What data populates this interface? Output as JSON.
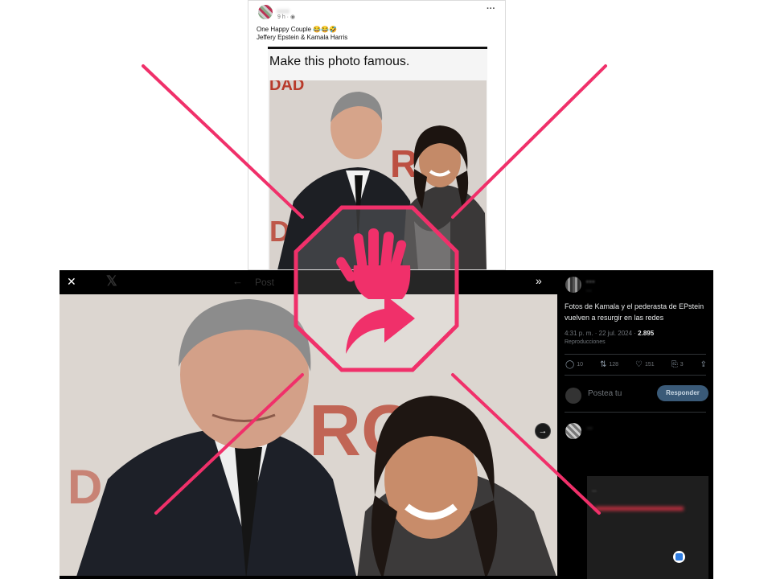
{
  "facebook_post": {
    "author": "...",
    "time": "9 h · ◉",
    "more": "···",
    "caption_line1": "One Happy Couple 😂😂🤣",
    "caption_line2": "Jeffery Epstein & Kamala Harris",
    "headline": "Make this photo famous."
  },
  "x_viewer": {
    "close": "✕",
    "logo": "𝕏",
    "back": "←",
    "post_title": "Post",
    "expand": "»",
    "next": "→",
    "author_name": "...",
    "author_handle": "...",
    "post_text": "Fotos de Kamala y el pederasta de EPstein vuelven a resurgir en las redes",
    "timestamp": "4:31 p. m. · 22 jul. 2024 · ",
    "views": "2.895",
    "views_label": "Reproducciones",
    "actions": [
      {
        "icon": "reply-icon",
        "glyph": "◯",
        "count": "10"
      },
      {
        "icon": "retweet-icon",
        "glyph": "⇅",
        "count": "128"
      },
      {
        "icon": "like-icon",
        "glyph": "♡",
        "count": "151"
      },
      {
        "icon": "bookmark-icon",
        "glyph": "⎘",
        "count": "3"
      },
      {
        "icon": "share-icon",
        "glyph": "⇪",
        "count": ""
      }
    ],
    "reply_placeholder": "Postea tu",
    "reply_button": "Responder",
    "comment_text": "...",
    "comment_card_text": "..."
  },
  "colors": {
    "warning_pink": "#f0306a",
    "x_background": "#000000",
    "reply_button": "#3a5a78"
  }
}
